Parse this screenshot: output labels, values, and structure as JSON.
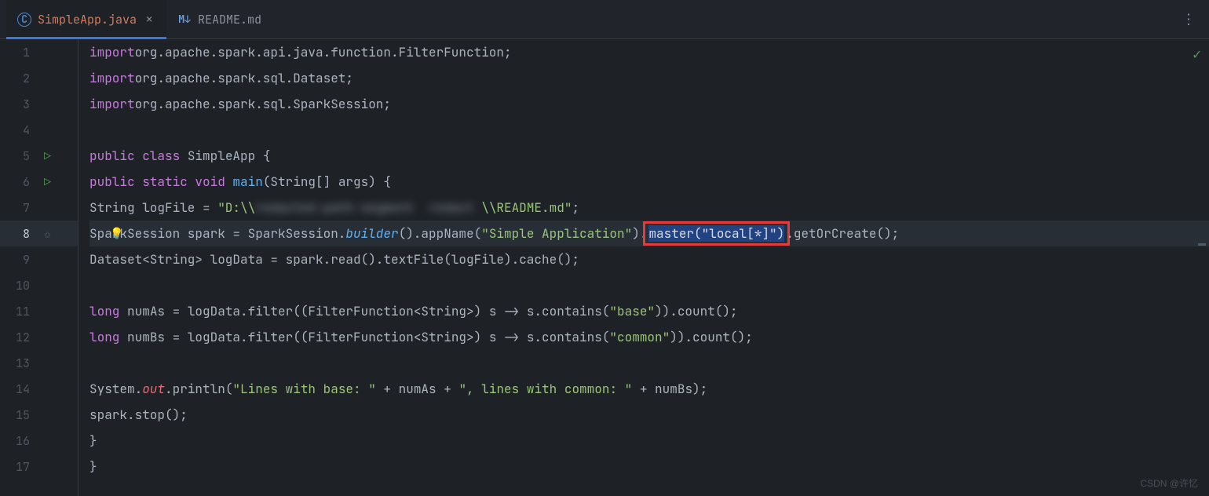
{
  "tabs": [
    {
      "icon": "C",
      "label": "SimpleApp.java",
      "active": true,
      "closable": true
    },
    {
      "icon": "M↓",
      "label": "README.md",
      "active": false,
      "closable": false
    }
  ],
  "status_check": "✓",
  "watermark": "CSDN @许忆",
  "code": {
    "l1": {
      "kw": "import",
      "pkg": "org.apache.spark.api.java.function.FilterFunction;"
    },
    "l2": {
      "kw": "import",
      "pkg": "org.apache.spark.sql.Dataset;"
    },
    "l3": {
      "kw": "import",
      "pkg": "org.apache.spark.sql.SparkSession;"
    },
    "l5": {
      "kw_public": "public ",
      "kw_class": "class ",
      "cls": "SimpleApp ",
      "brace": "{"
    },
    "l6": {
      "kw_public": "public ",
      "kw_static": "static ",
      "kw_void": "void ",
      "mtd": "main",
      "sig": "(String[] args) {"
    },
    "l7": {
      "decl": "String logFile = ",
      "str_open": "\"D:\\\\",
      "blurred": "redacted-path-segment  ",
      "blurred2": "redact ",
      "str_close": "\\\\README.md\"",
      "semi": ";"
    },
    "l8": {
      "a": "SparkSession spark = SparkSession.",
      "builder": "builder",
      "b": "().appName(",
      "str1": "\"Simple Application\"",
      "c": ").",
      "sel": "master(\"local[*]\")",
      "d": ".getOrCreate();"
    },
    "l9": {
      "txt": "Dataset<String> logData = spark.read().textFile(logFile).cache();"
    },
    "l11": {
      "kw_long": "long ",
      "a": "numAs = logData.filter((FilterFunction<String>) s -> s.contains(",
      "str": "\"base\"",
      "b": ")).count();"
    },
    "l12": {
      "kw_long": "long ",
      "a": "numBs = logData.filter((FilterFunction<String>) s -> s.contains(",
      "str": "\"common\"",
      "b": ")).count();"
    },
    "l14": {
      "a": "System.",
      "out": "out",
      "b": ".println(",
      "str1": "\"Lines with base: \"",
      "c": " + numAs + ",
      "str2": "\", lines with common: \"",
      "d": " + numBs);"
    },
    "l15": {
      "txt": "spark.stop();"
    },
    "l16": {
      "txt": "}"
    },
    "l17": {
      "txt": "}"
    }
  },
  "line_numbers": [
    "1",
    "2",
    "3",
    "4",
    "5",
    "6",
    "7",
    "8",
    "9",
    "10",
    "11",
    "12",
    "13",
    "14",
    "15",
    "16",
    "17"
  ]
}
